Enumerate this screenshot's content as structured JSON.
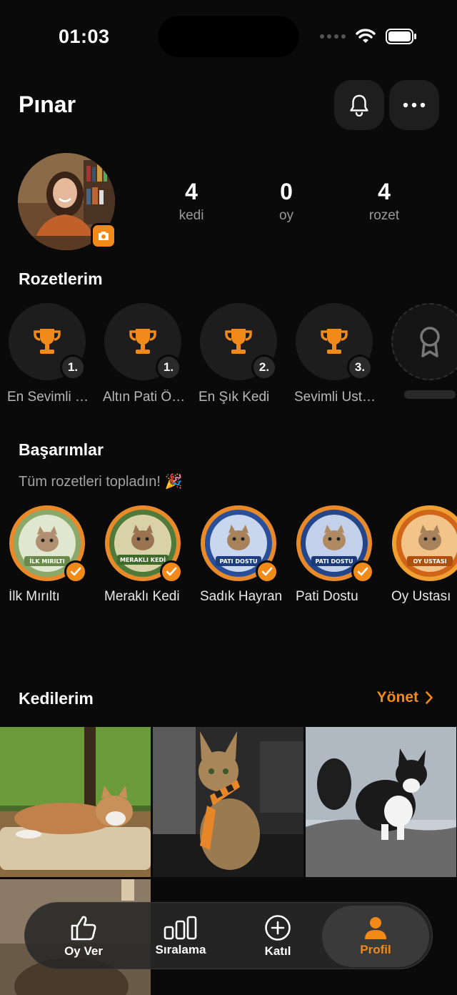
{
  "status_bar": {
    "time": "01:03"
  },
  "header": {
    "user_name": "Pınar"
  },
  "stats": [
    {
      "value": "4",
      "label": "kedi"
    },
    {
      "value": "0",
      "label": "oy"
    },
    {
      "value": "4",
      "label": "rozet"
    }
  ],
  "badges_section": {
    "title": "Rozetlerim",
    "items": [
      {
        "label": "En Sevimli Kedi",
        "rank": "1."
      },
      {
        "label": "Altın Pati Ödülü",
        "rank": "1."
      },
      {
        "label": "En Şık Kedi",
        "rank": "2."
      },
      {
        "label": "Sevimli Ustası",
        "rank": "3."
      }
    ]
  },
  "achievements": {
    "title": "Başarımlar",
    "subtitle": "Tüm rozetleri topladın! 🎉",
    "items": [
      {
        "label": "İlk Mırıltı",
        "medal_text": "İLK MIRILTI",
        "ring": "#7a9a5a"
      },
      {
        "label": "Meraklı Kedi",
        "medal_text": "MERAKLI KEDİ",
        "ring": "#4f7a3a"
      },
      {
        "label": "Sadık Hayran",
        "medal_text": "PATI DOSTU",
        "ring": "#2a4f9a"
      },
      {
        "label": "Pati Dostu",
        "medal_text": "PATI DOSTU",
        "ring": "#23458a"
      },
      {
        "label": "Oy Ustası",
        "medal_text": "OY USTASI",
        "ring": "#d0651a"
      }
    ]
  },
  "cats_section": {
    "title": "Kedilerim",
    "manage_label": "Yönet"
  },
  "tab_bar": {
    "tabs": [
      {
        "label": "Oy Ver"
      },
      {
        "label": "Sıralama"
      },
      {
        "label": "Katıl"
      },
      {
        "label": "Profil"
      }
    ]
  },
  "colors": {
    "accent": "#f28a1a",
    "background": "#0a0a0a",
    "surface": "#1d1d1d"
  }
}
